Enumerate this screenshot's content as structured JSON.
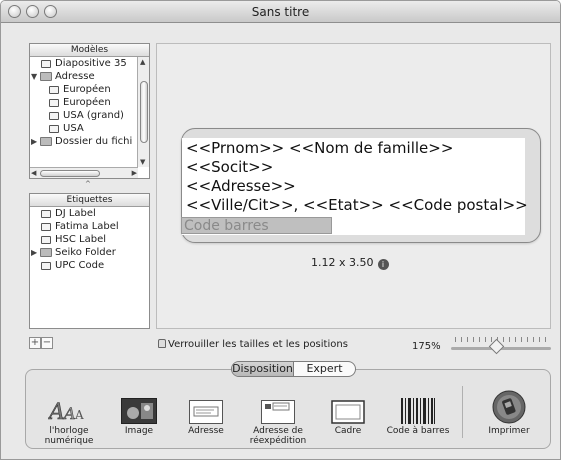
{
  "window": {
    "title": "Sans titre"
  },
  "models": {
    "header": "Modèles",
    "items": [
      {
        "label": "Diapositive 35",
        "type": "doc"
      },
      {
        "label": "Adresse",
        "type": "folder-open"
      },
      {
        "label": "Européen",
        "type": "doc"
      },
      {
        "label": "Européen",
        "type": "doc"
      },
      {
        "label": "USA (grand)",
        "type": "doc"
      },
      {
        "label": "USA",
        "type": "doc"
      },
      {
        "label": "Dossier du fichi",
        "type": "folder-closed"
      }
    ]
  },
  "labels_list": {
    "header": "Etiquettes",
    "items": [
      {
        "label": "DJ Label",
        "type": "doc"
      },
      {
        "label": "Fatima Label",
        "type": "doc"
      },
      {
        "label": "HSC Label",
        "type": "doc"
      },
      {
        "label": "Seiko Folder",
        "type": "folder-closed"
      },
      {
        "label": "UPC Code",
        "type": "doc"
      }
    ]
  },
  "label_preview": {
    "lines": [
      "<<Prnom>> <<Nom de famille>>",
      "<<Socit>>",
      "<<Adresse>>",
      "<<Ville/Cit>>, <<Etat>> <<Code postal>>"
    ],
    "barcode_placeholder": "Code  barres",
    "dimensions": "1.12 x 3.50",
    "info_glyph": "i"
  },
  "controls": {
    "add": "+",
    "remove": "−",
    "lock_text": "Verrouiller les tailles et les positions",
    "zoom": "175%",
    "zoom_fraction": 0.45
  },
  "mode_tabs": {
    "disposition": "Disposition",
    "expert": "Expert"
  },
  "toolbar": {
    "items": [
      {
        "label": "l'horloge\nnumérique",
        "icon": "clock-text-icon"
      },
      {
        "label": "Image",
        "icon": "image-icon"
      },
      {
        "label": "Adresse",
        "icon": "address-icon"
      },
      {
        "label": "Adresse de\nréexpédition",
        "icon": "return-address-icon"
      },
      {
        "label": "Cadre",
        "icon": "frame-icon"
      },
      {
        "label": "Code à barres",
        "icon": "barcode-icon"
      },
      {
        "label": "Imprimer",
        "icon": "print-icon"
      }
    ]
  },
  "colors": {
    "accent": "#7d7d7d",
    "background": "#e9e9e9"
  }
}
